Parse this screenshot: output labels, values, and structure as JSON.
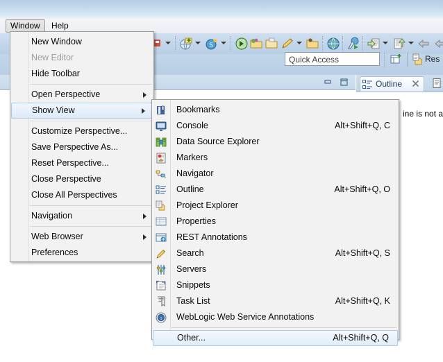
{
  "window": {
    "title_bar": "",
    "menubar": [
      {
        "label": "Window",
        "active": true
      },
      {
        "label": "Help",
        "active": false
      }
    ]
  },
  "toolbar": {
    "quick_access_placeholder": "Quick Access",
    "quick_access_value": "Quick Access",
    "perspective_label": "Res",
    "icons": [
      "new-web-project-icon",
      "new-server-icon",
      "external-tools-icon",
      "open-folder-icon",
      "open-type-icon",
      "pencil-icon",
      "open-resource-icon",
      "globe-icon",
      "debug-icon",
      "import-icon",
      "export-icon",
      "back-arrow-icon",
      "forward-arrow-icon"
    ]
  },
  "views": {
    "outline_tab_label": "Outline",
    "outline_message": "ine is not av",
    "minimize_title": "Minimize",
    "maximize_title": "Maximize"
  },
  "window_menu": {
    "items": [
      {
        "label": "New Window",
        "type": "item",
        "disabled": false,
        "submenu": false
      },
      {
        "label": "New Editor",
        "type": "item",
        "disabled": true,
        "submenu": false
      },
      {
        "label": "Hide Toolbar",
        "type": "item",
        "disabled": false,
        "submenu": false
      },
      {
        "label": "",
        "type": "sep"
      },
      {
        "label": "Open Perspective",
        "type": "item",
        "disabled": false,
        "submenu": true
      },
      {
        "label": "Show View",
        "type": "item",
        "disabled": false,
        "submenu": true,
        "selected": true
      },
      {
        "label": "",
        "type": "sep"
      },
      {
        "label": "Customize Perspective...",
        "type": "item",
        "disabled": false,
        "submenu": false
      },
      {
        "label": "Save Perspective As...",
        "type": "item",
        "disabled": false,
        "submenu": false
      },
      {
        "label": "Reset Perspective...",
        "type": "item",
        "disabled": false,
        "submenu": false
      },
      {
        "label": "Close Perspective",
        "type": "item",
        "disabled": false,
        "submenu": false
      },
      {
        "label": "Close All Perspectives",
        "type": "item",
        "disabled": false,
        "submenu": false
      },
      {
        "label": "",
        "type": "sep"
      },
      {
        "label": "Navigation",
        "type": "item",
        "disabled": false,
        "submenu": true
      },
      {
        "label": "",
        "type": "sep"
      },
      {
        "label": "Web Browser",
        "type": "item",
        "disabled": false,
        "submenu": true
      },
      {
        "label": "Preferences",
        "type": "item",
        "disabled": false,
        "submenu": false
      }
    ]
  },
  "show_view_menu": {
    "items": [
      {
        "label": "Bookmarks",
        "accel": "",
        "icon": "bookmarks-icon",
        "type": "item"
      },
      {
        "label": "Console",
        "accel": "Alt+Shift+Q, C",
        "icon": "console-icon",
        "type": "item"
      },
      {
        "label": "Data Source Explorer",
        "accel": "",
        "icon": "data-source-icon",
        "type": "item"
      },
      {
        "label": "Markers",
        "accel": "",
        "icon": "markers-icon",
        "type": "item"
      },
      {
        "label": "Navigator",
        "accel": "",
        "icon": "navigator-icon",
        "type": "item"
      },
      {
        "label": "Outline",
        "accel": "Alt+Shift+Q, O",
        "icon": "outline-icon",
        "type": "item"
      },
      {
        "label": "Project Explorer",
        "accel": "",
        "icon": "project-explorer-icon",
        "type": "item"
      },
      {
        "label": "Properties",
        "accel": "",
        "icon": "properties-icon",
        "type": "item"
      },
      {
        "label": "REST Annotations",
        "accel": "",
        "icon": "rest-annotations-icon",
        "type": "item"
      },
      {
        "label": "Search",
        "accel": "Alt+Shift+Q, S",
        "icon": "search-icon",
        "type": "item"
      },
      {
        "label": "Servers",
        "accel": "",
        "icon": "servers-icon",
        "type": "item"
      },
      {
        "label": "Snippets",
        "accel": "",
        "icon": "snippets-icon",
        "type": "item"
      },
      {
        "label": "Task List",
        "accel": "Alt+Shift+Q, K",
        "icon": "task-list-icon",
        "type": "item"
      },
      {
        "label": "WebLogic Web Service Annotations",
        "accel": "",
        "icon": "weblogic-icon",
        "type": "item"
      },
      {
        "label": "",
        "accel": "",
        "icon": "",
        "type": "sep"
      },
      {
        "label": "Other...",
        "accel": "Alt+Shift+Q, Q",
        "icon": "",
        "type": "item",
        "selected": true
      }
    ]
  },
  "colors": {
    "menu_bg": "#f2f2f2",
    "menu_border": "#9c9c9c",
    "highlight_border": "#a8cbe8",
    "titlebar_blue": "#b3cde4",
    "toolbar_blue": "#c3d6ea",
    "disabled_text": "#9d9d9d"
  }
}
